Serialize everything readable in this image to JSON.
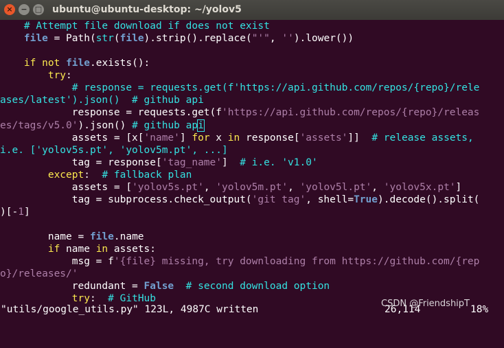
{
  "window": {
    "title": "ubuntu@ubuntu-desktop: ~/yolov5",
    "close_glyph": "×",
    "minimize_glyph": "−",
    "maximize_glyph": "□"
  },
  "editor": {
    "lines": [
      [
        {
          "t": "    "
        },
        {
          "t": "# Attempt file download if does not exist",
          "c": "c"
        }
      ],
      [
        {
          "t": "    "
        },
        {
          "t": "file",
          "c": "b bo"
        },
        {
          "t": " = Path("
        },
        {
          "t": "str",
          "c": "f"
        },
        {
          "t": "("
        },
        {
          "t": "file",
          "c": "b bo"
        },
        {
          "t": ").strip().replace("
        },
        {
          "t": "\"'\"",
          "c": "s"
        },
        {
          "t": ", "
        },
        {
          "t": "''",
          "c": "s"
        },
        {
          "t": ").lower())"
        }
      ],
      [
        {
          "t": ""
        }
      ],
      [
        {
          "t": "    "
        },
        {
          "t": "if",
          "c": "k"
        },
        {
          "t": " "
        },
        {
          "t": "not",
          "c": "k"
        },
        {
          "t": " "
        },
        {
          "t": "file",
          "c": "b bo"
        },
        {
          "t": ".exists():"
        }
      ],
      [
        {
          "t": "        "
        },
        {
          "t": "try",
          "c": "k"
        },
        {
          "t": ":"
        }
      ],
      [
        {
          "t": "            "
        },
        {
          "t": "# response = requests.get(f'https://api.github.com/repos/{repo}/rele",
          "c": "c"
        }
      ],
      [
        {
          "t": "ases/latest').json()  # github api",
          "c": "c"
        }
      ],
      [
        {
          "t": "            response = requests.get(f"
        },
        {
          "t": "'https://api.github.com/repos/{repo}/releas",
          "c": "s"
        }
      ],
      [
        {
          "t": "es/tags/v5.0'",
          "c": "s"
        },
        {
          "t": ").json() "
        },
        {
          "t": "# github ap",
          "c": "c"
        },
        {
          "t": "i",
          "c": "c cursor"
        }
      ],
      [
        {
          "t": "            assets = [x["
        },
        {
          "t": "'name'",
          "c": "s"
        },
        {
          "t": "] "
        },
        {
          "t": "for",
          "c": "k"
        },
        {
          "t": " x "
        },
        {
          "t": "in",
          "c": "k"
        },
        {
          "t": " response["
        },
        {
          "t": "'assets'",
          "c": "s"
        },
        {
          "t": "]]  "
        },
        {
          "t": "# release assets,",
          "c": "c"
        }
      ],
      [
        {
          "t": "i.e. ['yolov5s.pt', 'yolov5m.pt', ...]",
          "c": "c"
        }
      ],
      [
        {
          "t": "            tag = response["
        },
        {
          "t": "'tag_name'",
          "c": "s"
        },
        {
          "t": "]  "
        },
        {
          "t": "# i.e. 'v1.0'",
          "c": "c"
        }
      ],
      [
        {
          "t": "        "
        },
        {
          "t": "except",
          "c": "k"
        },
        {
          "t": ":  "
        },
        {
          "t": "# fallback plan",
          "c": "c"
        }
      ],
      [
        {
          "t": "            assets = ["
        },
        {
          "t": "'yolov5s.pt'",
          "c": "s"
        },
        {
          "t": ", "
        },
        {
          "t": "'yolov5m.pt'",
          "c": "s"
        },
        {
          "t": ", "
        },
        {
          "t": "'yolov5l.pt'",
          "c": "s"
        },
        {
          "t": ", "
        },
        {
          "t": "'yolov5x.pt'",
          "c": "s"
        },
        {
          "t": "]"
        }
      ],
      [
        {
          "t": "            tag = subprocess.check_output("
        },
        {
          "t": "'git tag'",
          "c": "s"
        },
        {
          "t": ", shell="
        },
        {
          "t": "True",
          "c": "b bo"
        },
        {
          "t": ").decode().split("
        }
      ],
      [
        {
          "t": ")[-"
        },
        {
          "t": "1",
          "c": "s"
        },
        {
          "t": "]"
        }
      ],
      [
        {
          "t": ""
        }
      ],
      [
        {
          "t": "        name = "
        },
        {
          "t": "file",
          "c": "b bo"
        },
        {
          "t": ".name"
        }
      ],
      [
        {
          "t": "        "
        },
        {
          "t": "if",
          "c": "k"
        },
        {
          "t": " name "
        },
        {
          "t": "in",
          "c": "k"
        },
        {
          "t": " assets:"
        }
      ],
      [
        {
          "t": "            msg = f"
        },
        {
          "t": "'{file} missing, try downloading from https://github.com/{rep",
          "c": "s"
        }
      ],
      [
        {
          "t": "o}/releases/'",
          "c": "s"
        }
      ],
      [
        {
          "t": "            redundant = "
        },
        {
          "t": "False",
          "c": "b bo"
        },
        {
          "t": "  "
        },
        {
          "t": "# second download option",
          "c": "c"
        }
      ],
      [
        {
          "t": "            "
        },
        {
          "t": "try",
          "c": "k"
        },
        {
          "t": ":  "
        },
        {
          "t": "# GitHub",
          "c": "c"
        }
      ]
    ]
  },
  "statusline": {
    "message": "\"utils/google_utils.py\" 123L, 4987C written",
    "position": "26,114",
    "percent": "18%"
  },
  "watermark": "CSDN @FriendshipT",
  "colors": {
    "background": "#300a24",
    "comment": "#34e2e2",
    "keyword": "#fce94f",
    "string": "#ad7fa8",
    "identifier": "#729fcf"
  }
}
